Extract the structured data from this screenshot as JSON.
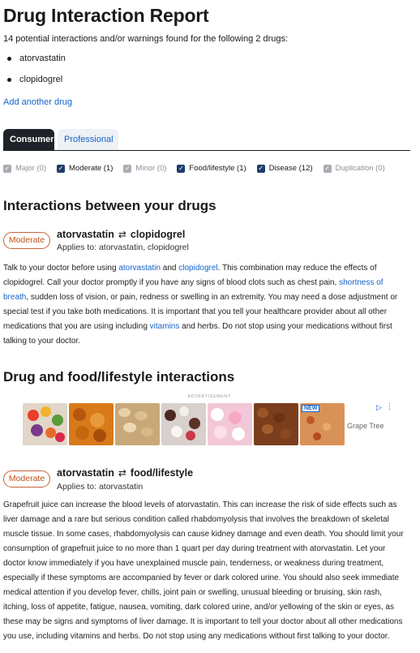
{
  "report": {
    "title": "Drug Interaction Report",
    "summary": "14 potential interactions and/or warnings found for the following 2 drugs:",
    "drugs": [
      "atorvastatin",
      "clopidogrel"
    ],
    "add_drug": "Add another drug"
  },
  "tabs": [
    {
      "label": "Consumer",
      "active": true
    },
    {
      "label": "Professional",
      "active": false
    }
  ],
  "filters": [
    {
      "label": "Major (0)",
      "checked": true,
      "enabled": false
    },
    {
      "label": "Moderate (1)",
      "checked": true,
      "enabled": true
    },
    {
      "label": "Minor (0)",
      "checked": true,
      "enabled": false
    },
    {
      "label": "Food/lifestyle (1)",
      "checked": true,
      "enabled": true
    },
    {
      "label": "Disease (12)",
      "checked": true,
      "enabled": true
    },
    {
      "label": "Duplication (0)",
      "checked": true,
      "enabled": false
    }
  ],
  "section_drugs": {
    "heading": "Interactions between your drugs",
    "interaction": {
      "severity": "Moderate",
      "drug_a": "atorvastatin",
      "drug_b": "clopidogrel",
      "arrow": "⇄",
      "applies_to": "Applies to: atorvastatin, clopidogrel",
      "text_parts": [
        {
          "t": "Talk to your doctor before using ",
          "link": false
        },
        {
          "t": "atorvastatin",
          "link": true
        },
        {
          "t": " and ",
          "link": false
        },
        {
          "t": "clopidogrel",
          "link": true
        },
        {
          "t": ". This combination may reduce the effects of clopidogrel. Call your doctor promptly if you have any signs of blood clots such as chest pain, ",
          "link": false
        },
        {
          "t": "shortness of breath",
          "link": true
        },
        {
          "t": ", sudden loss of vision, or pain, redness or swelling in an extremity. You may need a dose adjustment or special test if you take both medications. It is important that you tell your healthcare provider about all other medications that you are using including ",
          "link": false
        },
        {
          "t": "vitamins",
          "link": true
        },
        {
          "t": " and herbs. Do not stop using your medications without first talking to your doctor.",
          "link": false
        }
      ]
    }
  },
  "section_food": {
    "heading": "Drug and food/lifestyle interactions",
    "ad": {
      "label": "ADVERTISEMENT",
      "new_badge": "NEW",
      "brand": "Grape Tree",
      "play_icon": "adchoices-play-icon",
      "menu_icon": "more-vertical-icon"
    },
    "interaction": {
      "severity": "Moderate",
      "drug_a": "atorvastatin",
      "drug_b": "food/lifestyle",
      "arrow": "⇄",
      "applies_to": "Applies to: atorvastatin",
      "text": "Grapefruit juice can increase the blood levels of atorvastatin. This can increase the risk of side effects such as liver damage and a rare but serious condition called rhabdomyolysis that involves the breakdown of skeletal muscle tissue. In some cases, rhabdomyolysis can cause kidney damage and even death. You should limit your consumption of grapefruit juice to no more than 1 quart per day during treatment with atorvastatin. Let your doctor know immediately if you have unexplained muscle pain, tenderness, or weakness during treatment, especially if these symptoms are accompanied by fever or dark colored urine. You should also seek immediate medical attention if you develop fever, chills, joint pain or swelling, unusual bleeding or bruising, skin rash, itching, loss of appetite, fatigue, nausea, vomiting, dark colored urine, and/or yellowing of the skin or eyes, as these may be signs and symptoms of liver damage. It is important to tell your doctor about all other medications you use, including vitamins and herbs. Do not stop using any medications without first talking to your doctor."
    }
  },
  "colors": {
    "link": "#1464c8",
    "badge_moderate": "#c0521c",
    "tab_active_bg": "#1f2329",
    "tab_inactive_bg": "#eef1f6",
    "checkbox_on": "#1e3c6e",
    "checkbox_disabled": "#a8acb4"
  }
}
